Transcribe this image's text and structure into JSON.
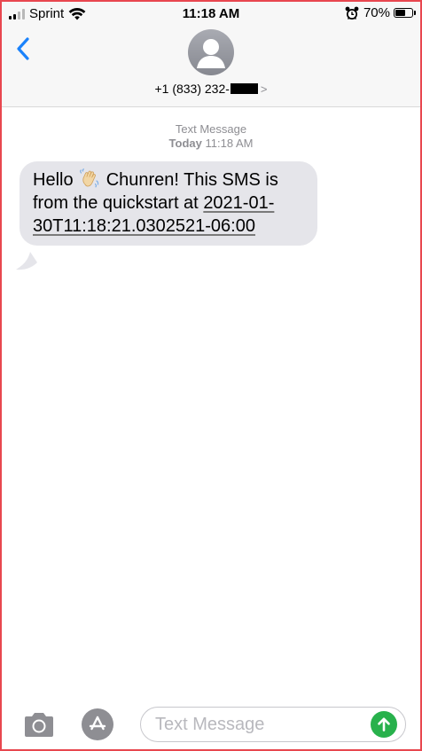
{
  "status_bar": {
    "carrier": "Sprint",
    "time": "11:18 AM",
    "battery_percent": "70%",
    "battery_level": 0.7,
    "signal_icon": "cellular-signal-icon",
    "wifi_icon": "wifi-icon",
    "alarm_icon": "alarm-clock-icon"
  },
  "header": {
    "back_icon": "chevron-left-icon",
    "avatar_icon": "person-silhouette-icon",
    "contact_number": "+1 (833) 232-",
    "contact_chevron": ">"
  },
  "conversation": {
    "service_label": "Text Message",
    "day": "Today",
    "time": "11:18 AM",
    "message": {
      "part1": "Hello",
      "emoji_icon": "waving-hand-emoji",
      "part2": "Chunren! This SMS is from the quickstart at",
      "timestamp": "2021-01-30T11:18:21.0302521-06:00"
    }
  },
  "input_bar": {
    "camera_icon": "camera-icon",
    "apps_icon": "app-store-icon",
    "placeholder": "Text Message",
    "send_icon": "send-arrow-up-icon"
  },
  "colors": {
    "accent_blue": "#1a82fb",
    "bubble_gray": "#e5e5ea",
    "meta_gray": "#8e8e93",
    "send_green": "#28b14c",
    "frame_red": "#e8474f"
  }
}
